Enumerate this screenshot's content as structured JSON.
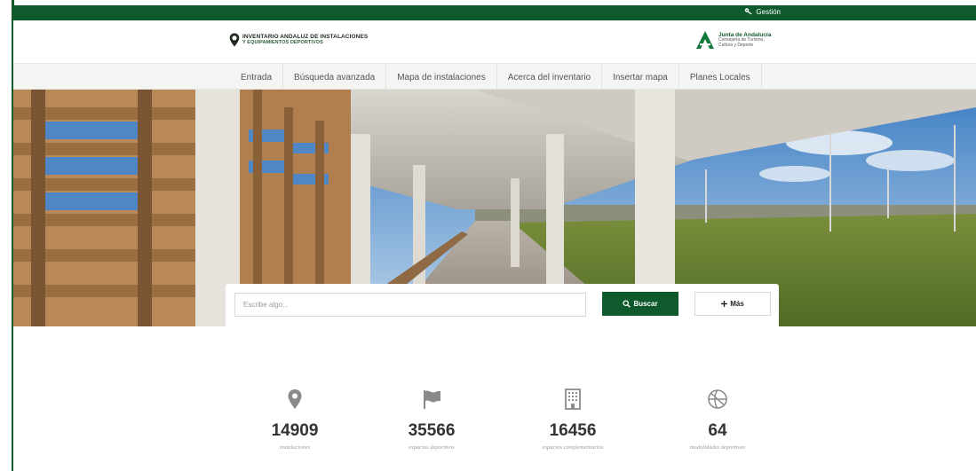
{
  "topbar": {
    "gestion_label": "Gestión",
    "key_icon": "key-icon"
  },
  "brand": {
    "line1": "INVENTARIO ANDALUZ DE INSTALACIONES",
    "line2": "Y EQUIPAMIENTOS DEPORTIVOS",
    "logo_icon": "map-pin-logo"
  },
  "junta": {
    "title": "Junta de Andalucía",
    "sub1": "Consejería de Turismo,",
    "sub2": "Cultura y Deporte",
    "logo_icon": "junta-a-logo"
  },
  "nav": {
    "items": [
      {
        "label": "Entrada"
      },
      {
        "label": "Búsqueda avanzada"
      },
      {
        "label": "Mapa de instalaciones"
      },
      {
        "label": "Acerca del inventario"
      },
      {
        "label": "Insertar mapa"
      },
      {
        "label": "Planes Locales"
      }
    ]
  },
  "search": {
    "placeholder": "Escribe algo...",
    "value": "",
    "search_label": "Buscar",
    "search_icon": "search-icon",
    "more_label": "Más",
    "more_icon": "plus-icon"
  },
  "stats": [
    {
      "icon": "map-marker-icon",
      "number": "14909",
      "label": "instalaciones"
    },
    {
      "icon": "flag-icon",
      "number": "35566",
      "label": "espacios deportivos"
    },
    {
      "icon": "building-icon",
      "number": "16456",
      "label": "espacios complementarios"
    },
    {
      "icon": "basketball-icon",
      "number": "64",
      "label": "modalidades deportivas"
    }
  ],
  "colors": {
    "brand_green": "#0f5a2c",
    "nav_bg": "#f4f4f2",
    "stat_icon": "#8a8a8a"
  }
}
